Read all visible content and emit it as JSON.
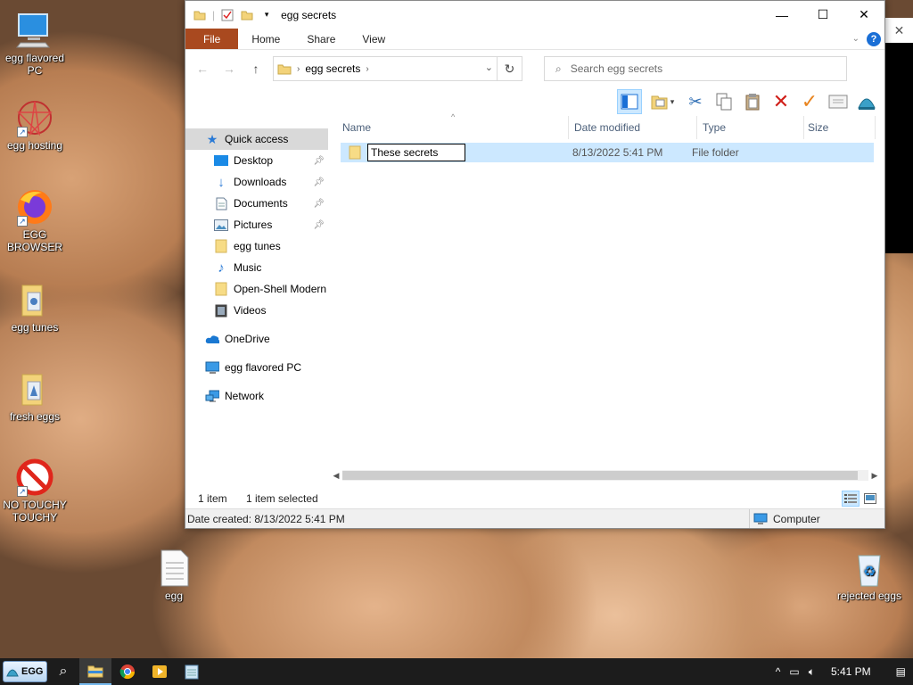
{
  "desktop": {
    "icons": [
      {
        "label": "egg flavored PC"
      },
      {
        "label": "egg hosting"
      },
      {
        "label": "EGG BROWSER"
      },
      {
        "label": "egg tunes"
      },
      {
        "label": "fresh eggs"
      },
      {
        "label": "NO TOUCHY TOUCHY"
      },
      {
        "label": "egg"
      },
      {
        "label": "rejected eggs"
      }
    ]
  },
  "window": {
    "title": "egg secrets",
    "controls": {
      "minimize": "—",
      "maximize": "☐",
      "close": "✕"
    },
    "ribbon_tabs": {
      "file": "File",
      "home": "Home",
      "share": "Share",
      "view": "View"
    },
    "address": {
      "crumb": "egg secrets"
    },
    "search": {
      "placeholder": "Search egg secrets"
    },
    "nav": {
      "quick_access": "Quick access",
      "desktop": "Desktop",
      "downloads": "Downloads",
      "documents": "Documents",
      "pictures": "Pictures",
      "egg_tunes": "egg tunes",
      "music": "Music",
      "open_shell": "Open-Shell Modern",
      "videos": "Videos",
      "onedrive": "OneDrive",
      "this_pc": "egg flavored PC",
      "network": "Network"
    },
    "columns": {
      "name": "Name",
      "date": "Date modified",
      "type": "Type",
      "size": "Size"
    },
    "rows": [
      {
        "name": "These secrets ",
        "date": "8/13/2022 5:41 PM",
        "type": "File folder"
      }
    ],
    "status": {
      "count": "1 item",
      "selected": "1 item selected"
    },
    "statusbar": {
      "created": "Date created: 8/13/2022 5:41 PM",
      "location": "Computer"
    }
  },
  "taskbar": {
    "start_label": "EGG",
    "clock": "5:41 PM"
  },
  "colors": {
    "file_tab": "#a9491f",
    "selection": "#cce8ff",
    "accent": "#1a6fd6"
  }
}
